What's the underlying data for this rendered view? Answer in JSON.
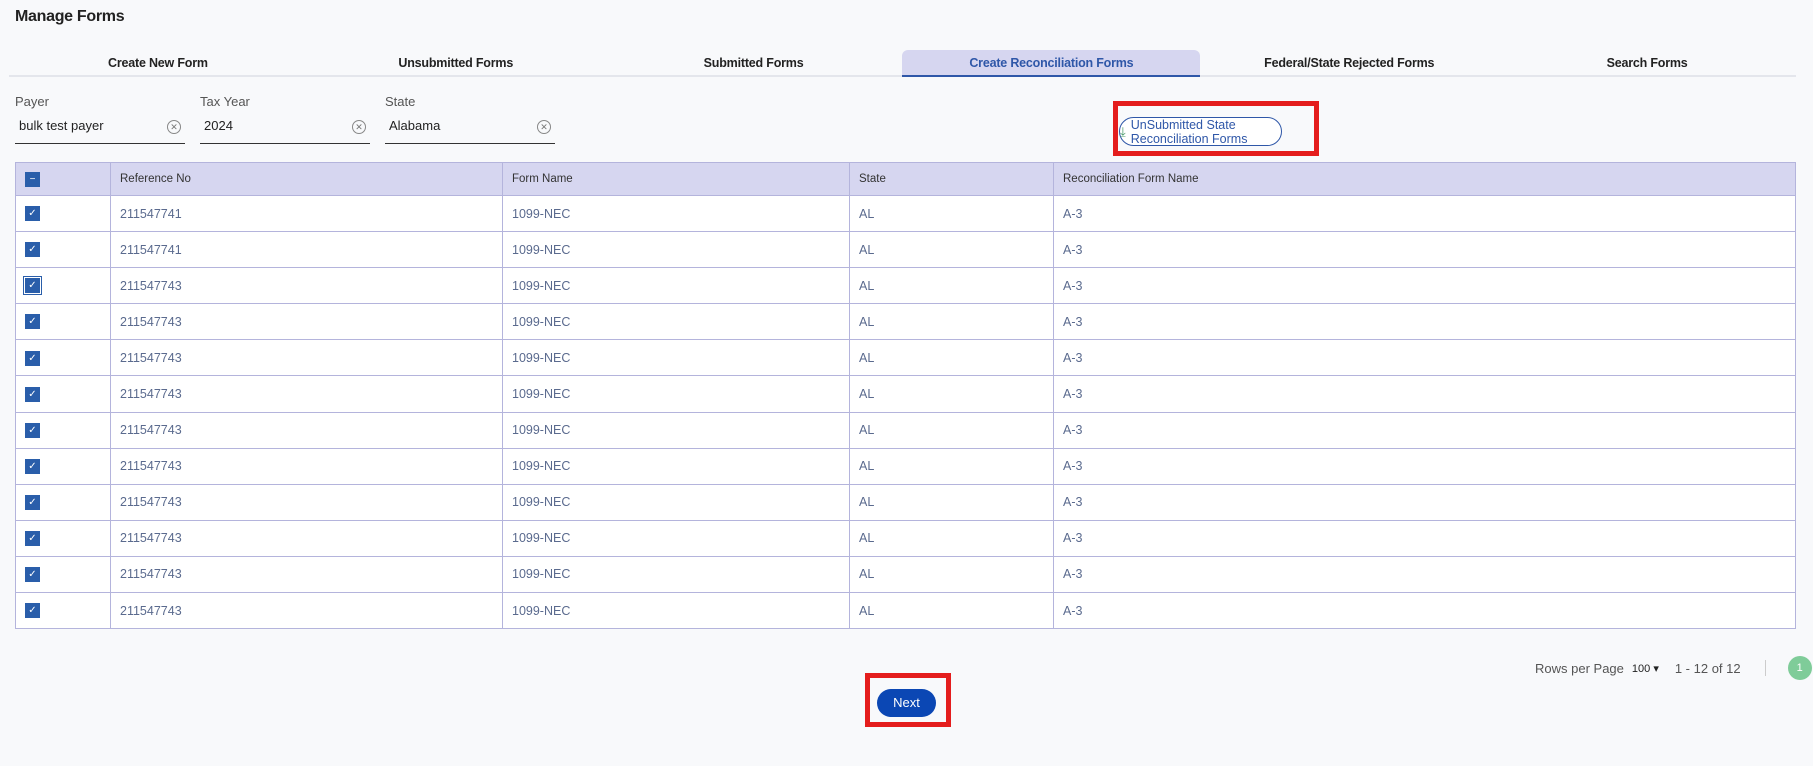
{
  "title": "Manage Forms",
  "tabs": [
    {
      "label": "Create New Form"
    },
    {
      "label": "Unsubmitted Forms"
    },
    {
      "label": "Submitted Forms"
    },
    {
      "label": "Create Reconciliation Forms",
      "active": true
    },
    {
      "label": "Federal/State Rejected Forms"
    },
    {
      "label": "Search Forms"
    }
  ],
  "filters": {
    "payer": {
      "label": "Payer",
      "value": "bulk test payer"
    },
    "tax_year": {
      "label": "Tax Year",
      "value": "2024"
    },
    "state": {
      "label": "State",
      "value": "Alabama"
    }
  },
  "download_button": "UnSubmitted State Reconciliation Forms",
  "table": {
    "headers": [
      "Reference No",
      "Form Name",
      "State",
      "Reconciliation Form Name"
    ],
    "rows": [
      [
        "211547741",
        "1099-NEC",
        "AL",
        "A-3"
      ],
      [
        "211547741",
        "1099-NEC",
        "AL",
        "A-3"
      ],
      [
        "211547743",
        "1099-NEC",
        "AL",
        "A-3"
      ],
      [
        "211547743",
        "1099-NEC",
        "AL",
        "A-3"
      ],
      [
        "211547743",
        "1099-NEC",
        "AL",
        "A-3"
      ],
      [
        "211547743",
        "1099-NEC",
        "AL",
        "A-3"
      ],
      [
        "211547743",
        "1099-NEC",
        "AL",
        "A-3"
      ],
      [
        "211547743",
        "1099-NEC",
        "AL",
        "A-3"
      ],
      [
        "211547743",
        "1099-NEC",
        "AL",
        "A-3"
      ],
      [
        "211547743",
        "1099-NEC",
        "AL",
        "A-3"
      ],
      [
        "211547743",
        "1099-NEC",
        "AL",
        "A-3"
      ],
      [
        "211547743",
        "1099-NEC",
        "AL",
        "A-3"
      ]
    ]
  },
  "pagination": {
    "rows_per_page_label": "Rows per Page",
    "rows_per_page": "100",
    "range": "1 - 12 of 12",
    "current_page": "1"
  },
  "next_button": "Next"
}
